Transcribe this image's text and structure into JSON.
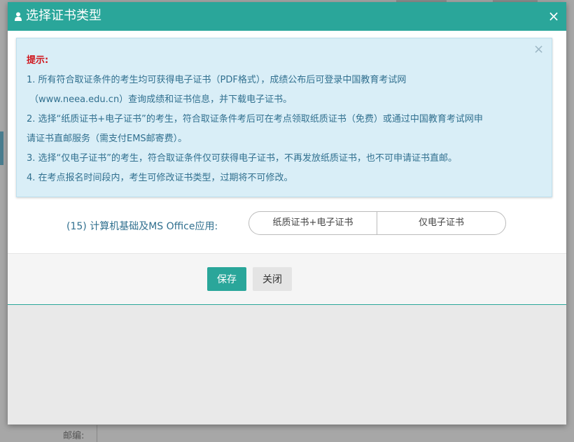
{
  "background": {
    "zip_label": "邮编:"
  },
  "modal": {
    "title": "选择证书类型",
    "header_icon": "user-icon",
    "close_glyph": "×",
    "colors": {
      "accent": "#2aa69a",
      "alert_bg": "#d9eef7",
      "alert_text": "#31708f",
      "warn": "#d0141b"
    }
  },
  "alert": {
    "close_glyph": "×",
    "title": "提示:",
    "lines": [
      "1. 所有符合取证条件的考生均可获得电子证书（PDF格式），成绩公布后可登录中国教育考试网",
      "（www.neea.edu.cn）查询成绩和证书信息，并下载电子证书。",
      "2. 选择“纸质证书+电子证书”的考生，符合取证条件考后可在考点领取纸质证书（免费）或通过中国教育考试网申",
      "请证书直邮服务（需支付EMS邮寄费）。",
      "3. 选择“仅电子证书”的考生，符合取证条件仅可获得电子证书，不再发放纸质证书，也不可申请证书直邮。",
      "4. 在考点报名时间段内，考生可修改证书类型，过期将不可修改。"
    ]
  },
  "subject": {
    "label": "(15) 计算机基础及MS Office应用:",
    "options": [
      "纸质证书+电子证书",
      "仅电子证书"
    ]
  },
  "footer": {
    "save_label": "保存",
    "close_label": "关闭"
  }
}
